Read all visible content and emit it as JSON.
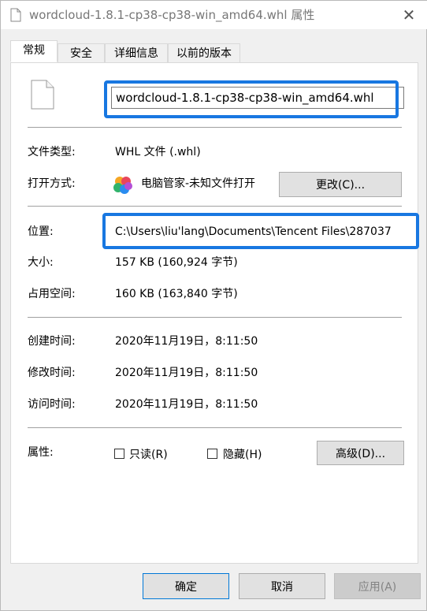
{
  "window": {
    "title": "wordcloud-1.8.1-cp38-cp38-win_amd64.whl 属性",
    "close_glyph": "✕"
  },
  "tabs": [
    {
      "label": "常规",
      "active": true
    },
    {
      "label": "安全",
      "active": false
    },
    {
      "label": "详细信息",
      "active": false
    },
    {
      "label": "以前的版本",
      "active": false
    }
  ],
  "general": {
    "file_name": "wordcloud-1.8.1-cp38-cp38-win_amd64.whl",
    "file_type_label": "文件类型:",
    "file_type_value": "WHL 文件 (.whl)",
    "open_with_label": "打开方式:",
    "open_with_value": "电脑管家-未知文件打开",
    "change_button": "更改(C)...",
    "location_label": "位置:",
    "location_value": "C:\\Users\\liu'lang\\Documents\\Tencent Files\\287037",
    "size_label": "大小:",
    "size_value": "157 KB (160,924 字节)",
    "disk_size_label": "占用空间:",
    "disk_size_value": "160 KB (163,840 字节)",
    "created_label": "创建时间:",
    "created_value": "2020年11月19日，8:11:50",
    "modified_label": "修改时间:",
    "modified_value": "2020年11月19日，8:11:50",
    "accessed_label": "访问时间:",
    "accessed_value": "2020年11月19日，8:11:50",
    "attributes_label": "属性:",
    "readonly_label": "只读(R)",
    "hidden_label": "隐藏(H)",
    "advanced_button": "高级(D)..."
  },
  "footer": {
    "ok_button": "确定",
    "cancel_button": "取消",
    "apply_button": "应用(A)"
  },
  "colors": {
    "highlight": "#1877e1",
    "window_bg": "#f0f0f0",
    "panel_bg": "#ffffff"
  }
}
